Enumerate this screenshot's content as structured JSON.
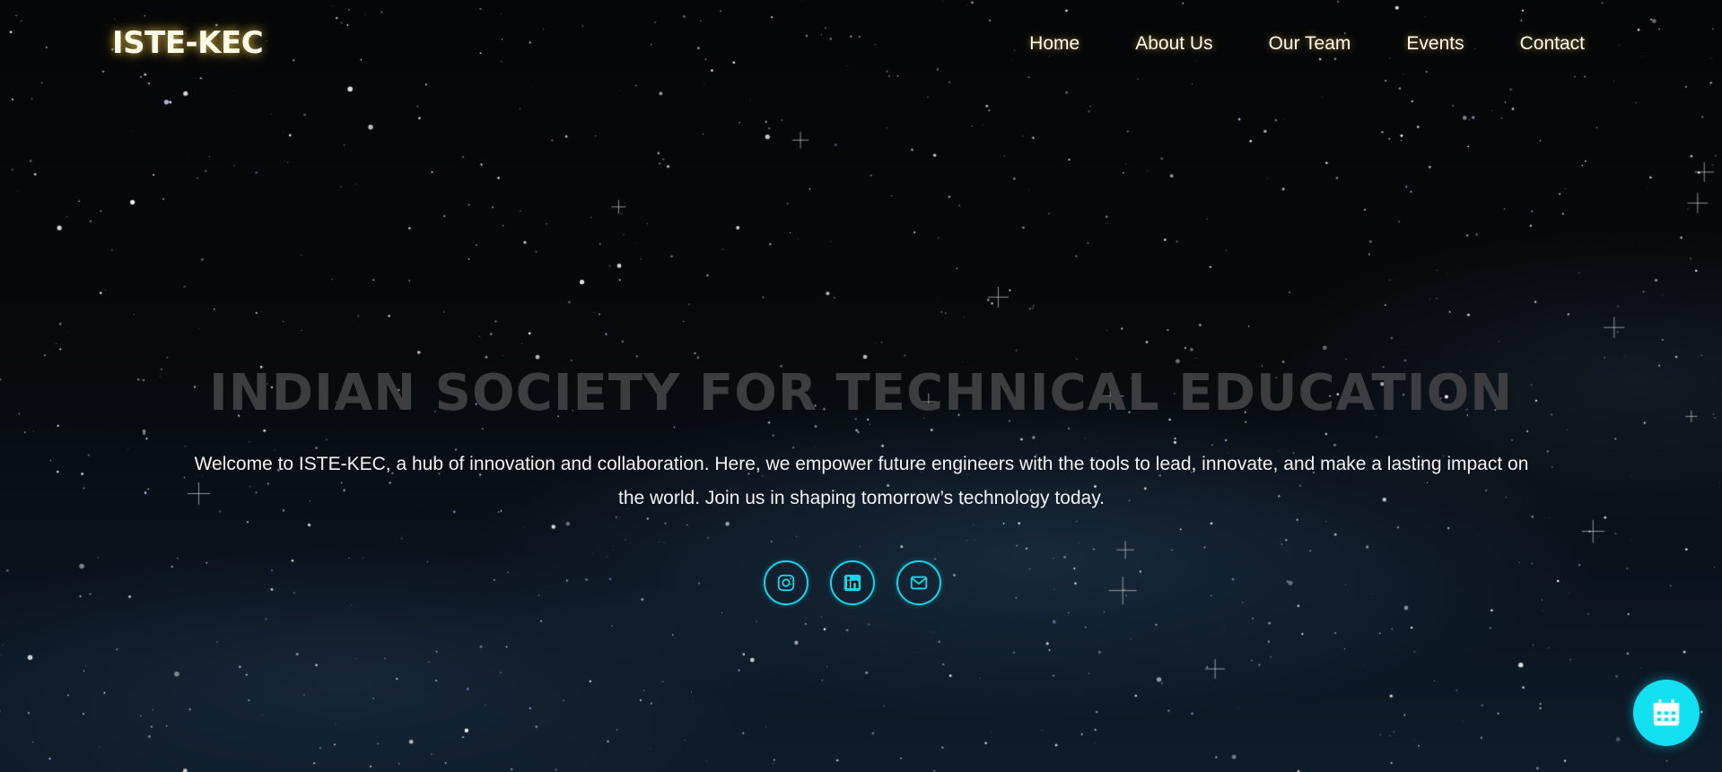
{
  "header": {
    "logo": "ISTE-KEC",
    "nav": [
      {
        "label": "Home"
      },
      {
        "label": "About Us"
      },
      {
        "label": "Our Team"
      },
      {
        "label": "Events"
      },
      {
        "label": "Contact"
      }
    ]
  },
  "hero": {
    "title": "INDIAN SOCIETY FOR TECHNICAL EDUCATION",
    "description": "Welcome to ISTE-KEC, a hub of innovation and collaboration. Here, we empower future engineers with the tools to lead, innovate, and make a lasting impact on the world. Join us in shaping tomorrow’s technology today."
  },
  "socials": [
    {
      "icon": "instagram-icon"
    },
    {
      "icon": "linkedin-icon"
    },
    {
      "icon": "mail-icon"
    }
  ],
  "floating_button": {
    "icon": "calendar-icon"
  },
  "colors": {
    "accent": "#12d6ea",
    "logo_glow": "#ffd85a",
    "title": "#3b3d40",
    "background": "#050607"
  }
}
